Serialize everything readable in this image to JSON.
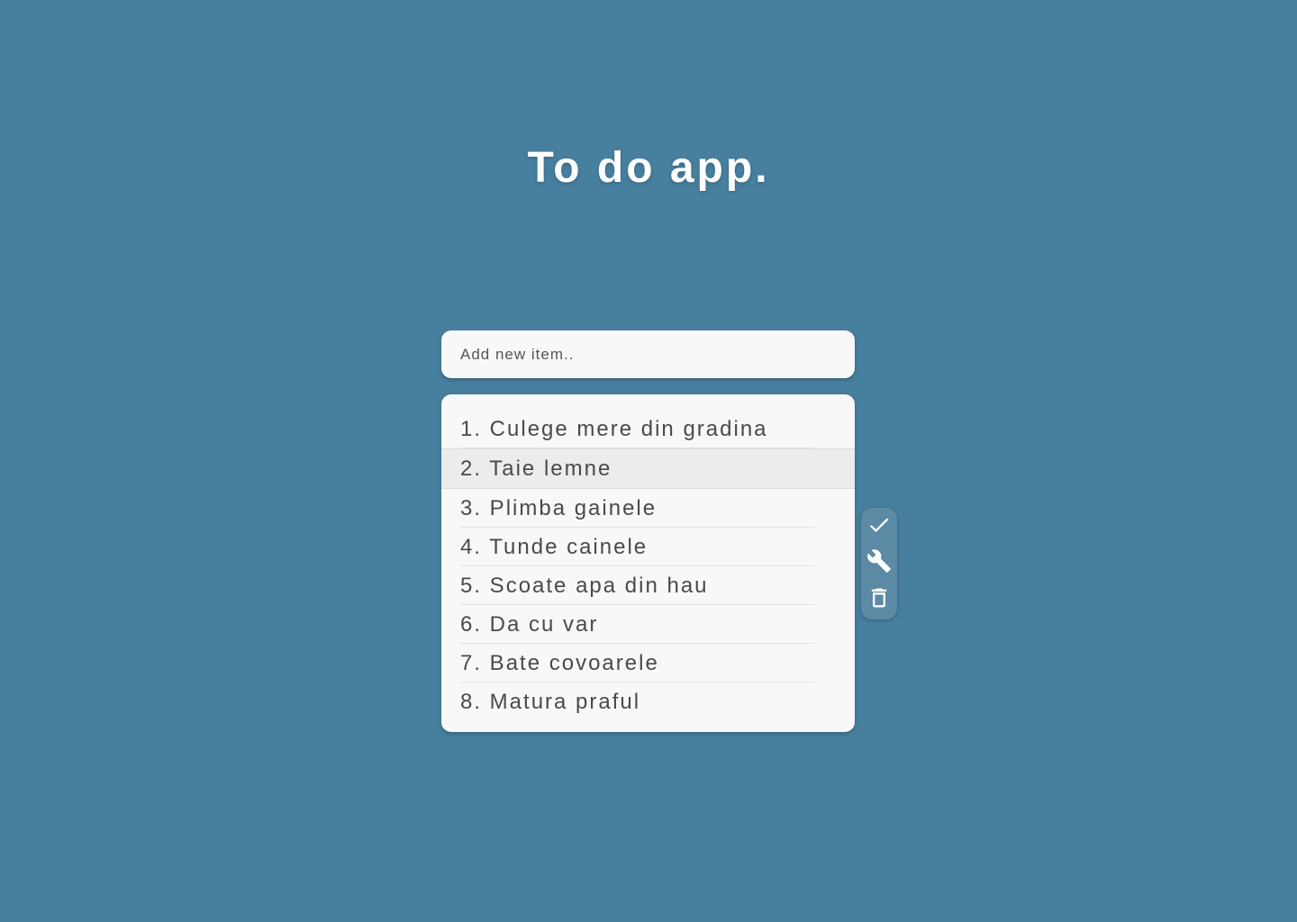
{
  "header": {
    "title": "To do app."
  },
  "new_item": {
    "placeholder": "Add new item.."
  },
  "todo": {
    "items": [
      {
        "label": "1. Culege mere din gradina"
      },
      {
        "label": "2. Taie lemne"
      },
      {
        "label": "3. Plimba gainele"
      },
      {
        "label": "4. Tunde cainele"
      },
      {
        "label": "5. Scoate apa din hau"
      },
      {
        "label": "6. Da cu var"
      },
      {
        "label": "7. Bate covoarele"
      },
      {
        "label": "8. Matura praful"
      }
    ],
    "selected_index": 1
  },
  "actions": {
    "complete_icon": "check-icon",
    "edit_icon": "wrench-icon",
    "delete_icon": "trash-icon"
  },
  "colors": {
    "background": "#477f9f",
    "card": "#f8f8f8",
    "selected_row": "#ececec",
    "action_rail": "#5b8aa5",
    "title_text": "#ffffff",
    "item_text": "#4a4a4a"
  }
}
